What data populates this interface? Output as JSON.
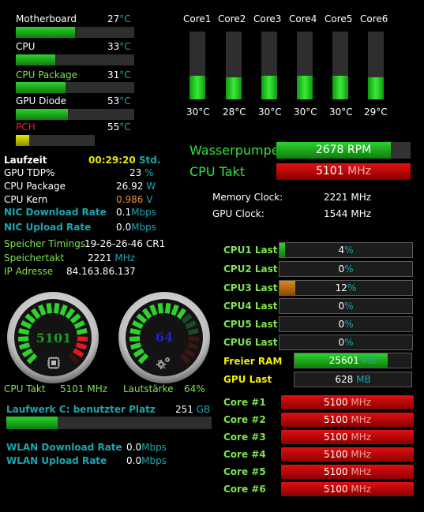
{
  "temps": [
    {
      "label": "Motherboard",
      "value": "27",
      "unit": "°C",
      "fraction": 0.5,
      "color": "green"
    },
    {
      "label": "CPU",
      "value": "33",
      "unit": "°C",
      "fraction": 0.33,
      "color": "green"
    },
    {
      "label": "CPU Package",
      "value": "31",
      "unit": "°C",
      "fraction": 0.42,
      "color": "green",
      "labelColor": "#7fe34d"
    },
    {
      "label": "GPU Diode",
      "value": "53",
      "unit": "°C",
      "fraction": 0.44,
      "color": "green"
    },
    {
      "label": "PCH",
      "value": "55",
      "unit": "°C",
      "fraction": 0.17,
      "color": "yellow",
      "labelColor": "#e02020"
    }
  ],
  "cores": [
    {
      "label": "Core1",
      "value": "30°C",
      "fraction": 0.35
    },
    {
      "label": "Core2",
      "value": "28°C",
      "fraction": 0.32
    },
    {
      "label": "Core3",
      "value": "30°C",
      "fraction": 0.35
    },
    {
      "label": "Core4",
      "value": "30°C",
      "fraction": 0.35
    },
    {
      "label": "Core5",
      "value": "30°C",
      "fraction": 0.35
    },
    {
      "label": "Core6",
      "value": "29°C",
      "fraction": 0.33
    }
  ],
  "pump": {
    "label": "Wasserpumpe",
    "value": "2678",
    "unit": "RPM",
    "fraction": 0.85
  },
  "cpuTakt": {
    "label": "CPU Takt",
    "value": "5101",
    "unit": "MHz"
  },
  "memClock": {
    "label": "Memory Clock:",
    "value": "2221",
    "unit": "MHz"
  },
  "gpuClock": {
    "label": "GPU Clock:",
    "value": "1544",
    "unit": "MHz"
  },
  "laufzeit": {
    "label": "Laufzeit",
    "value": "00:29:20",
    "unit": "Std."
  },
  "info": [
    {
      "label": "GPU TDP%",
      "value": "23",
      "unit": "%",
      "valueColor": "#ffffff"
    },
    {
      "label": "CPU Package",
      "value": "26.92",
      "unit": "W",
      "valueColor": "#ffffff"
    },
    {
      "label": "CPU Kern",
      "value": "0.986",
      "unit": "V",
      "valueColor": "#f08a30"
    },
    {
      "label": "NIC Download Rate",
      "value": "0.1",
      "unit": "Mbps",
      "valueColor": "#ffffff",
      "bold": true
    },
    {
      "label": "NIC Upload Rate",
      "value": "0.0",
      "unit": "Mbps",
      "valueColor": "#ffffff",
      "bold": true
    }
  ],
  "memTimings": {
    "label": "Speicher Timings",
    "value": "19-26-26-46 CR1"
  },
  "memTakt": {
    "label": "Speichertakt",
    "value": "2221",
    "unit": "MHz"
  },
  "ip": {
    "label": "IP Adresse",
    "value": "84.163.86.137"
  },
  "gauges": [
    {
      "display": "5101",
      "caption": "CPU Takt",
      "value": "5101",
      "unit": "MHz",
      "numberColor": "#1f9a1f",
      "level": 0.95
    },
    {
      "display": "64",
      "caption": "Lautstärke",
      "value": "64",
      "unit": "%",
      "numberColor": "#2020d0",
      "level": 0.64
    }
  ],
  "cpuLoads": [
    {
      "label": "CPU1 Last",
      "value": "4",
      "unit": "%",
      "fraction": 0.04,
      "color": "green"
    },
    {
      "label": "CPU2 Last",
      "value": "0",
      "unit": "%",
      "fraction": 0.0,
      "color": "green"
    },
    {
      "label": "CPU3 Last",
      "value": "12",
      "unit": "%",
      "fraction": 0.12,
      "color": "orange"
    },
    {
      "label": "CPU4 Last",
      "value": "0",
      "unit": "%",
      "fraction": 0.0,
      "color": "green"
    },
    {
      "label": "CPU5 Last",
      "value": "0",
      "unit": "%",
      "fraction": 0.0,
      "color": "green"
    },
    {
      "label": "CPU6 Last",
      "value": "0",
      "unit": "%",
      "fraction": 0.0,
      "color": "green"
    }
  ],
  "freeRam": {
    "label": "Freier RAM",
    "value": "25601",
    "unit": "MB",
    "fraction": 0.8
  },
  "gpuLast": {
    "label": "GPU Last",
    "value": "628",
    "unit": "MB",
    "fraction": 0.0
  },
  "drive": {
    "label": "Laufwerk C: benutzter Platz",
    "value": "251",
    "unit": "GB",
    "fraction": 0.25
  },
  "wlan": [
    {
      "label": "WLAN Download Rate",
      "value": "0.0",
      "unit": "Mbps"
    },
    {
      "label": "WLAN Upload Rate",
      "value": "0.0",
      "unit": "Mbps"
    }
  ],
  "coreClocks": [
    {
      "label": "Core #1",
      "value": "5100",
      "unit": "MHz"
    },
    {
      "label": "Core #2",
      "value": "5100",
      "unit": "MHz"
    },
    {
      "label": "Core #3",
      "value": "5100",
      "unit": "MHz"
    },
    {
      "label": "Core #4",
      "value": "5100",
      "unit": "MHz"
    },
    {
      "label": "Core #5",
      "value": "5100",
      "unit": "MHz"
    },
    {
      "label": "Core #6",
      "value": "5100",
      "unit": "MHz"
    }
  ]
}
